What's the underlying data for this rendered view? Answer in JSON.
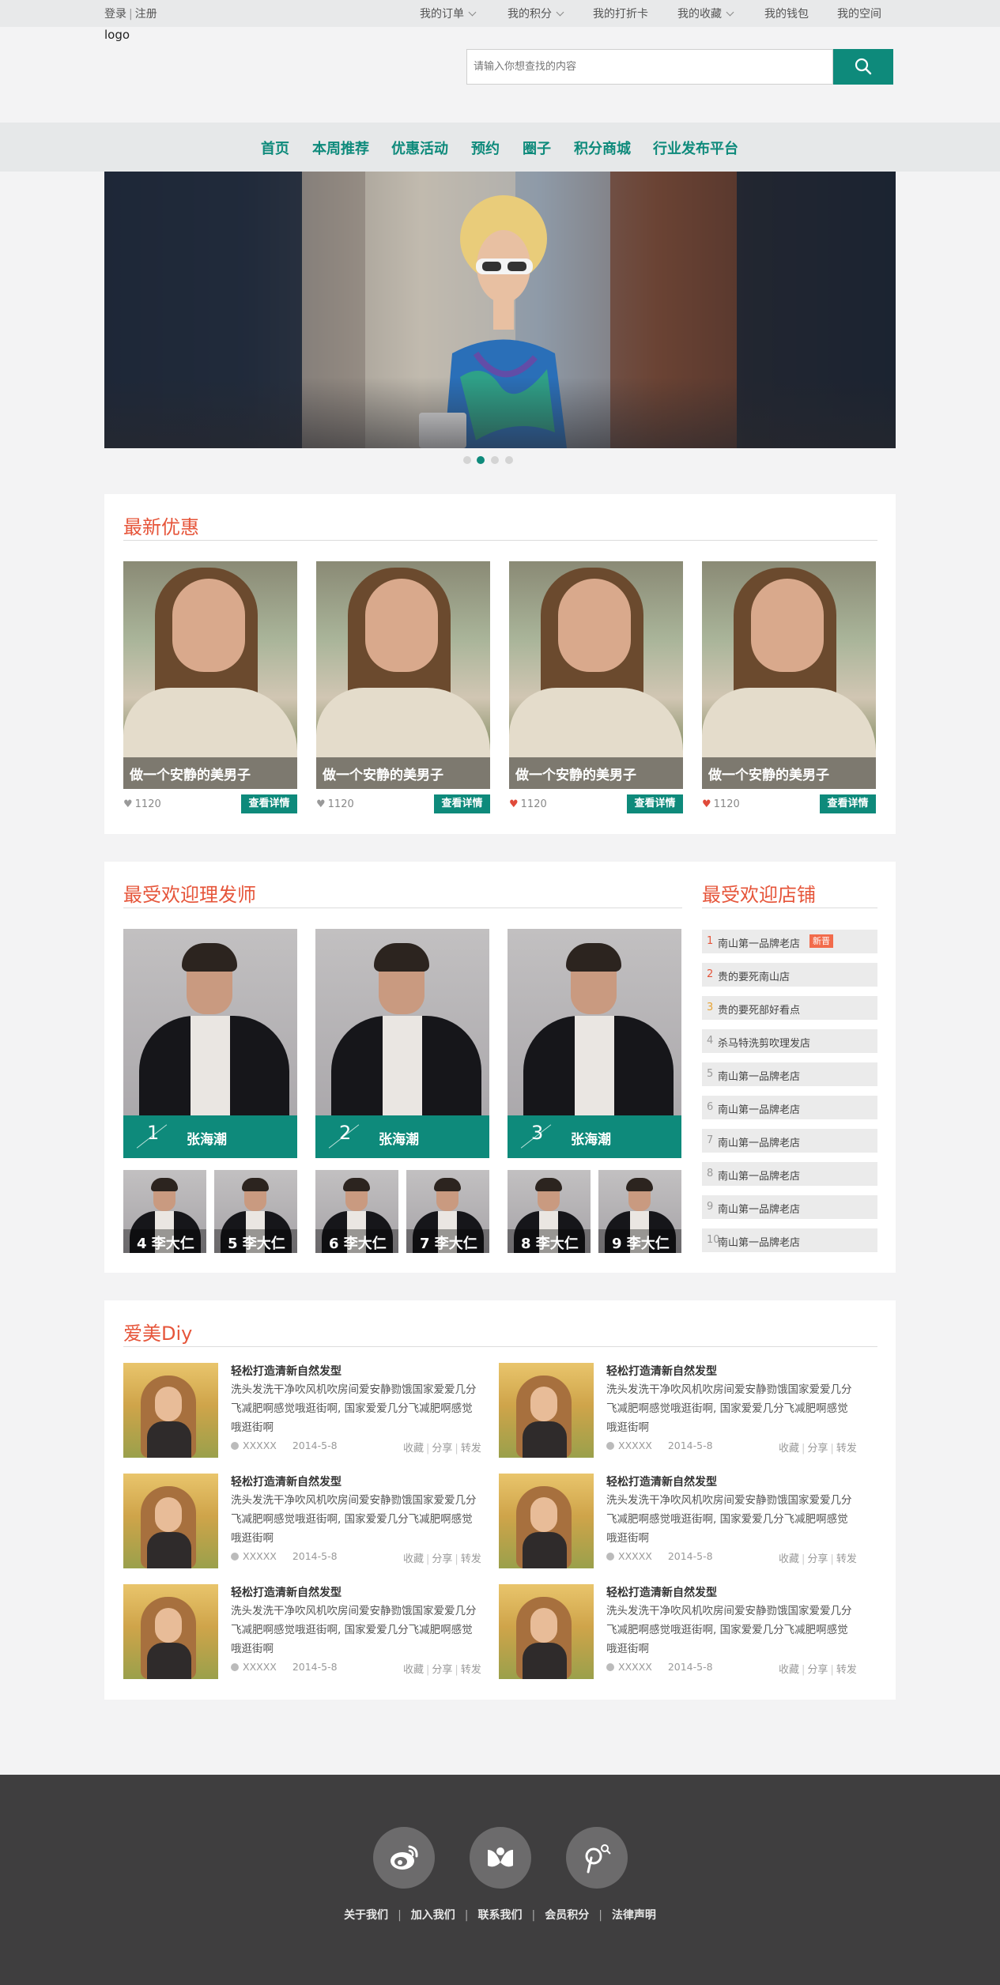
{
  "topbar": {
    "login": "登录",
    "register": "注册",
    "items": [
      {
        "label": "我的订单",
        "dropdown": true
      },
      {
        "label": "我的积分",
        "dropdown": true
      },
      {
        "label": "我的打折卡",
        "dropdown": false
      },
      {
        "label": "我的收藏",
        "dropdown": true
      },
      {
        "label": "我的钱包",
        "dropdown": false
      },
      {
        "label": "我的空间",
        "dropdown": false
      }
    ]
  },
  "header": {
    "logo": "logo",
    "search_placeholder": "请输入你想查找的内容"
  },
  "nav": {
    "items": [
      "首页",
      "本周推荐",
      "优惠活动",
      "预约",
      "圈子",
      "积分商城",
      "行业发布平台"
    ]
  },
  "banner": {
    "slide_count": 4,
    "active_slide": 1
  },
  "deals": {
    "title": "最新优惠",
    "cards": [
      {
        "caption": "做一个安静的美男子",
        "likes": "1120",
        "liked": false,
        "button": "查看详情"
      },
      {
        "caption": "做一个安静的美男子",
        "likes": "1120",
        "liked": false,
        "button": "查看详情"
      },
      {
        "caption": "做一个安静的美男子",
        "likes": "1120",
        "liked": true,
        "button": "查看详情"
      },
      {
        "caption": "做一个安静的美男子",
        "likes": "1120",
        "liked": true,
        "button": "查看详情"
      }
    ]
  },
  "stylists": {
    "title": "最受欢迎理发师",
    "top": [
      {
        "rank": "1",
        "name": "张海潮"
      },
      {
        "rank": "2",
        "name": "张海潮"
      },
      {
        "rank": "3",
        "name": "张海潮"
      }
    ],
    "others": [
      "4 李大仁",
      "5 李大仁",
      "6 李大仁",
      "7 李大仁",
      "8 李大仁",
      "9 李大仁"
    ]
  },
  "shops": {
    "title": "最受欢迎店铺",
    "items": [
      {
        "rank": "1",
        "name": "南山第一品牌老店",
        "tag": "新晋"
      },
      {
        "rank": "2",
        "name": "贵的要死南山店",
        "tag": ""
      },
      {
        "rank": "3",
        "name": "贵的要死部好看点",
        "tag": ""
      },
      {
        "rank": "4",
        "name": "杀马特洗剪吹理发店",
        "tag": ""
      },
      {
        "rank": "5",
        "name": "南山第一品牌老店",
        "tag": ""
      },
      {
        "rank": "6",
        "name": "南山第一品牌老店",
        "tag": ""
      },
      {
        "rank": "7",
        "name": "南山第一品牌老店",
        "tag": ""
      },
      {
        "rank": "8",
        "name": "南山第一品牌老店",
        "tag": ""
      },
      {
        "rank": "9",
        "name": "南山第一品牌老店",
        "tag": ""
      },
      {
        "rank": "10",
        "name": "南山第一品牌老店",
        "tag": ""
      }
    ]
  },
  "diy": {
    "title": "爱美Diy",
    "articles": [
      {
        "title": "轻松打造清新自然发型",
        "text": "洗头发洗干净吹风机吹房间爱安静勠饿国家爱爱几分飞减肥啊感觉哦逛街啊, 国家爱爱几分飞减肥啊感觉哦逛街啊",
        "author": "XXXXX",
        "date": "2014-5-8",
        "actions": [
          "收藏",
          "分享",
          "转发"
        ]
      },
      {
        "title": "轻松打造清新自然发型",
        "text": "洗头发洗干净吹风机吹房间爱安静勠饿国家爱爱几分飞减肥啊感觉哦逛街啊, 国家爱爱几分飞减肥啊感觉哦逛街啊",
        "author": "XXXXX",
        "date": "2014-5-8",
        "actions": [
          "收藏",
          "分享",
          "转发"
        ]
      },
      {
        "title": "轻松打造清新自然发型",
        "text": "洗头发洗干净吹风机吹房间爱安静勠饿国家爱爱几分飞减肥啊感觉哦逛街啊, 国家爱爱几分飞减肥啊感觉哦逛街啊",
        "author": "XXXXX",
        "date": "2014-5-8",
        "actions": [
          "收藏",
          "分享",
          "转发"
        ]
      },
      {
        "title": "轻松打造清新自然发型",
        "text": "洗头发洗干净吹风机吹房间爱安静勠饿国家爱爱几分飞减肥啊感觉哦逛街啊, 国家爱爱几分飞减肥啊感觉哦逛街啊",
        "author": "XXXXX",
        "date": "2014-5-8",
        "actions": [
          "收藏",
          "分享",
          "转发"
        ]
      },
      {
        "title": "轻松打造清新自然发型",
        "text": "洗头发洗干净吹风机吹房间爱安静勠饿国家爱爱几分飞减肥啊感觉哦逛街啊, 国家爱爱几分飞减肥啊感觉哦逛街啊",
        "author": "XXXXX",
        "date": "2014-5-8",
        "actions": [
          "收藏",
          "分享",
          "转发"
        ]
      },
      {
        "title": "轻松打造清新自然发型",
        "text": "洗头发洗干净吹风机吹房间爱安静勠饿国家爱爱几分飞减肥啊感觉哦逛街啊, 国家爱爱几分飞减肥啊感觉哦逛街啊",
        "author": "XXXXX",
        "date": "2014-5-8",
        "actions": [
          "收藏",
          "分享",
          "转发"
        ]
      }
    ]
  },
  "footer": {
    "social": [
      "weibo-icon",
      "renren-icon",
      "tencent-weibo-icon"
    ],
    "links": [
      "关于我们",
      "加入我们",
      "联系我们",
      "会员积分",
      "法律声明"
    ]
  },
  "colors": {
    "accent": "#0e8a7b",
    "title": "#e6553a",
    "heart_on": "#e04a3a",
    "heart_off": "#999999",
    "footer_bg": "#3f3e3f"
  }
}
